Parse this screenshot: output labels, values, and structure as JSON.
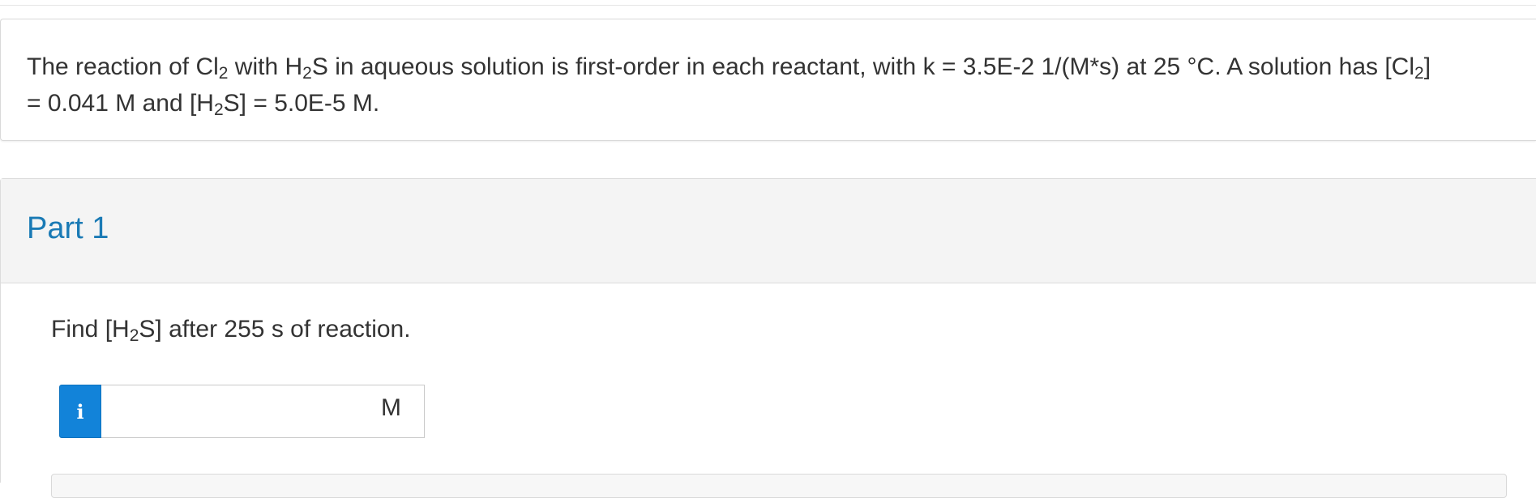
{
  "question": {
    "intro": "The reaction of Cl",
    "cl_sub": "2",
    "with_text": " with H",
    "h_sub": "2",
    "body_text": "S in aqueous solution is first-order in each reactant, with k = 3.5E-2 1/(M*s) at 25 °C. A solution has [Cl",
    "cl2_sub": "2",
    "line2_start": "]",
    "line2_text": "= 0.041 M and [H",
    "h2_sub": "2",
    "line2_end": "S] = 5.0E-5 M."
  },
  "part": {
    "title": "Part 1",
    "prompt_start": "Find [H",
    "prompt_sub": "2",
    "prompt_end": "S] after 255 s of reaction.",
    "info_label": "i",
    "answer_value": "",
    "unit": "M"
  }
}
